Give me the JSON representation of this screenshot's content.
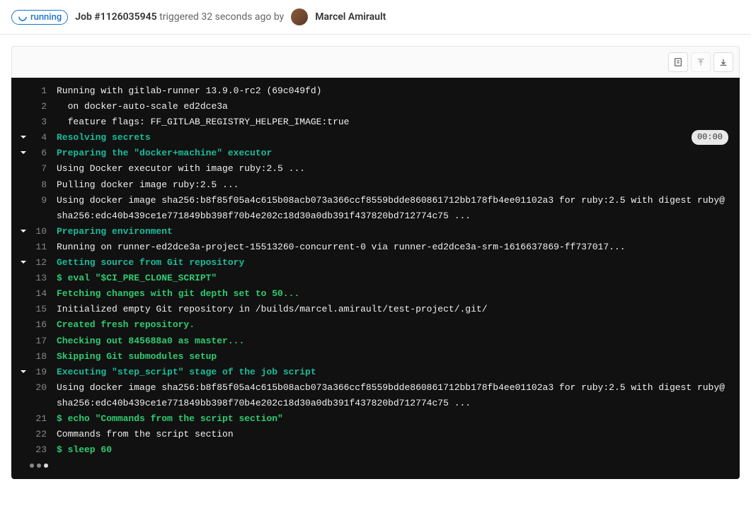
{
  "header": {
    "status": "running",
    "job_label": "Job #1126035945",
    "triggered_text": "triggered 32 seconds ago by",
    "author_name": "Marcel Amirault"
  },
  "toolbar": {
    "raw_title": "Show raw",
    "scroll_top_title": "Scroll to top",
    "scroll_bottom_title": "Scroll to bottom"
  },
  "log": {
    "lines": [
      {
        "n": 1,
        "chev": false,
        "cls": "",
        "text": "Running with gitlab-runner 13.9.0-rc2 (69c049fd)"
      },
      {
        "n": 2,
        "chev": false,
        "cls": "",
        "text": "  on docker-auto-scale ed2dce3a"
      },
      {
        "n": 3,
        "chev": false,
        "cls": "",
        "text": "  feature flags: FF_GITLAB_REGISTRY_HELPER_IMAGE:true"
      },
      {
        "n": 4,
        "chev": true,
        "cls": "cyan",
        "text": "Resolving secrets",
        "dur": "00:00"
      },
      {
        "n": 6,
        "chev": true,
        "cls": "cyan",
        "text": "Preparing the \"docker+machine\" executor"
      },
      {
        "n": 7,
        "chev": false,
        "cls": "",
        "text": "Using Docker executor with image ruby:2.5 ..."
      },
      {
        "n": 8,
        "chev": false,
        "cls": "",
        "text": "Pulling docker image ruby:2.5 ..."
      },
      {
        "n": 9,
        "chev": false,
        "cls": "",
        "text": "Using docker image sha256:b8f85f05a4c615b08acb073a366ccf8559bdde860861712bb178fb4ee01102a3 for ruby:2.5 with digest ruby@sha256:edc40b439ce1e771849bb398f70b4e202c18d30a0db391f437820bd712774c75 ..."
      },
      {
        "n": 10,
        "chev": true,
        "cls": "cyan",
        "text": "Preparing environment"
      },
      {
        "n": 11,
        "chev": false,
        "cls": "",
        "text": "Running on runner-ed2dce3a-project-15513260-concurrent-0 via runner-ed2dce3a-srm-1616637869-ff737017..."
      },
      {
        "n": 12,
        "chev": true,
        "cls": "cyan",
        "text": "Getting source from Git repository"
      },
      {
        "n": 13,
        "chev": false,
        "cls": "green",
        "text": "$ eval \"$CI_PRE_CLONE_SCRIPT\""
      },
      {
        "n": 14,
        "chev": false,
        "cls": "green",
        "text": "Fetching changes with git depth set to 50..."
      },
      {
        "n": 15,
        "chev": false,
        "cls": "",
        "text": "Initialized empty Git repository in /builds/marcel.amirault/test-project/.git/"
      },
      {
        "n": 16,
        "chev": false,
        "cls": "green",
        "text": "Created fresh repository."
      },
      {
        "n": 17,
        "chev": false,
        "cls": "green",
        "text": "Checking out 845688a0 as master..."
      },
      {
        "n": 18,
        "chev": false,
        "cls": "green",
        "text": "Skipping Git submodules setup"
      },
      {
        "n": 19,
        "chev": true,
        "cls": "cyan",
        "text": "Executing \"step_script\" stage of the job script"
      },
      {
        "n": 20,
        "chev": false,
        "cls": "",
        "text": "Using docker image sha256:b8f85f05a4c615b08acb073a366ccf8559bdde860861712bb178fb4ee01102a3 for ruby:2.5 with digest ruby@sha256:edc40b439ce1e771849bb398f70b4e202c18d30a0db391f437820bd712774c75 ..."
      },
      {
        "n": 21,
        "chev": false,
        "cls": "green",
        "text": "$ echo \"Commands from the script section\""
      },
      {
        "n": 22,
        "chev": false,
        "cls": "",
        "text": "Commands from the script section"
      },
      {
        "n": 23,
        "chev": false,
        "cls": "green",
        "text": "$ sleep 60"
      }
    ]
  }
}
